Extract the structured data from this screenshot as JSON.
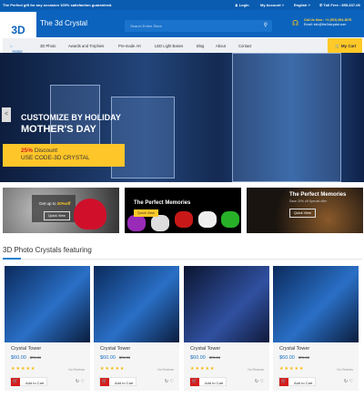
{
  "topbar": {
    "tagline": "The Perfect gift for any occasion 100% satisfaction guaranteed.",
    "login": "Login",
    "account": "My Account",
    "language": "English",
    "tollfree": "Toll Free : 855-337-06"
  },
  "header": {
    "logo": "3D",
    "site_name": "The 3d Crystal",
    "search_placeholder": "Search Entire Store",
    "call_label": "Call Us Now :",
    "call_number": "+1 (503) 694-3675",
    "email": "Email: info@the3dcrystal.com"
  },
  "nav": {
    "items": [
      "Home",
      "3D Photo",
      "Awards and Trophies",
      "Pre-made Art",
      "LED Light Bases",
      "Blog",
      "About",
      "Contact"
    ],
    "cart": "My Cart"
  },
  "hero": {
    "line1": "CUSTOMIZE BY HOLIDAY",
    "line2": "MOTHER'S DAY",
    "discount_pct": "25%",
    "discount_word": "Discount",
    "code": "USE CODE-3D CRYSTAL",
    "prev": "<",
    "next": ">"
  },
  "banners": [
    {
      "text_prefix": "Get up to ",
      "highlight": "20%off",
      "button": "Quick View"
    },
    {
      "title": "The Perfect Memories",
      "button": "Quick View"
    },
    {
      "title": "The Perfect Memories",
      "subtitle": "Save 20% off Special offer",
      "button": "Quick View"
    }
  ],
  "section": {
    "title": "3D Photo Crystals featuring"
  },
  "products": [
    {
      "name": "Crystal Tower",
      "price": "$60.00",
      "old_price": "$76.00",
      "rating": 5,
      "reviews": "No Reviews",
      "button": "Add to Cart"
    },
    {
      "name": "Crystal Tower",
      "price": "$60.00",
      "old_price": "$76.00",
      "rating": 5,
      "reviews": "No Reviews",
      "button": "Add to Cart"
    },
    {
      "name": "Crystal Tower",
      "price": "$60.00",
      "old_price": "$76.00",
      "rating": 5,
      "reviews": "No Reviews",
      "button": "Add to Cart"
    },
    {
      "name": "Crystal Tower",
      "price": "$60.00",
      "old_price": "$76.00",
      "rating": 5,
      "reviews": "No Reviews",
      "button": "Add to Cart"
    }
  ],
  "colors": {
    "brand": "#0b63bd",
    "accent": "#ffc928",
    "cart_red": "#d51c1c"
  }
}
